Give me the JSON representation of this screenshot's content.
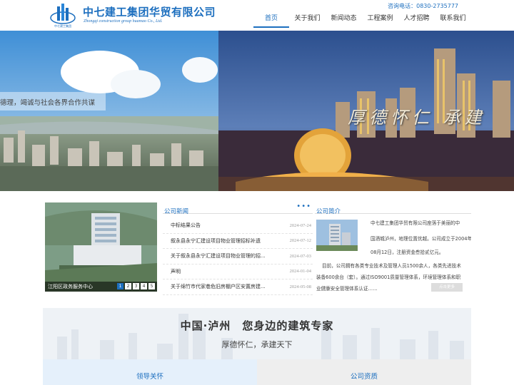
{
  "header": {
    "company_name": "中七建工集团华贸有限公司",
    "company_name_en": "Zhongqi construction group huamao Co., Ltd.",
    "logo_text": "中七建工集团",
    "hotline": "咨询电话：0830-2735777",
    "nav": [
      {
        "label": "首页",
        "active": true
      },
      {
        "label": "关于我们",
        "active": false
      },
      {
        "label": "新闻动态",
        "active": false
      },
      {
        "label": "工程案例",
        "active": false
      },
      {
        "label": "人才招聘",
        "active": false
      },
      {
        "label": "联系我们",
        "active": false
      }
    ]
  },
  "banner": {
    "caption": "德理，竭诚与社会各界合作共谋",
    "slogan": "厚德怀仁 承建"
  },
  "project": {
    "caption": "江阳区政务服务中心",
    "pages": [
      "1",
      "2",
      "3",
      "4",
      "5"
    ],
    "current_page": 1
  },
  "news": {
    "title": "公司新闻",
    "more": "•••",
    "items": [
      {
        "title": "中标结果公告",
        "date": "2024-07-24"
      },
      {
        "title": "叙永县永宁汇建设项目物业管理招标补遗",
        "date": "2024-07-12"
      },
      {
        "title": "关于叙永县永宁汇建设项目物业管理的招...",
        "date": "2024-07-03"
      },
      {
        "title": "声明",
        "date": "2024-01-04"
      },
      {
        "title": "关于绵竹市代家巷危旧房棚户区安置房建...",
        "date": "2024-05-08"
      }
    ]
  },
  "about": {
    "title": "公司简介",
    "lines": [
      "中七建工集团华贸有限公司座落于美丽的中",
      "国酒城泸州，地理位置优越。公司成立于2004年",
      "08月12日，注册资金叁拾贰亿元。",
      "目前，公司拥有各类专业技术及管理人员1500余人，各类先进技术",
      "装备600余台（套）。通过ISO9001质量管理体系，环境管理体系和职",
      "业健康安全管理体系认证……"
    ],
    "more_button": "点击更多"
  },
  "slogan": {
    "main": "中国·泸州　您身边的建筑专家",
    "sub": "厚德怀仁，承建天下"
  },
  "tabs": [
    {
      "label": "领导关怀"
    },
    {
      "label": "公司资质"
    }
  ],
  "colors": {
    "brand": "#1d6fbf",
    "text": "#333333",
    "muted": "#999999"
  }
}
